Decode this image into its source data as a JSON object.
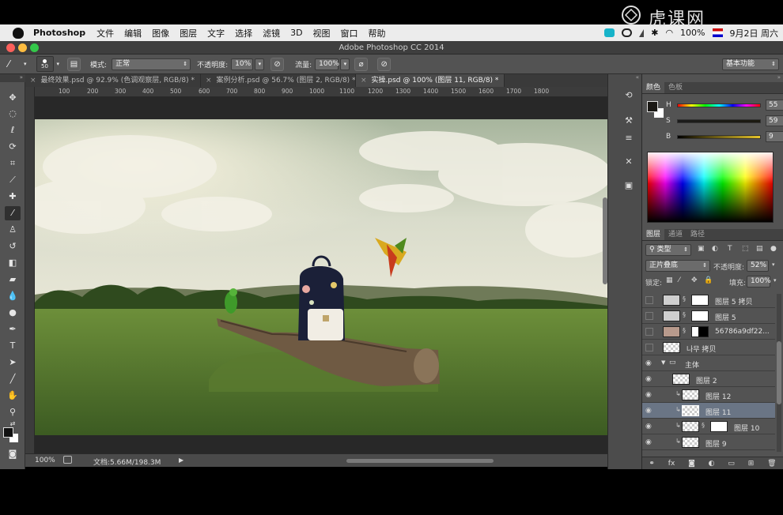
{
  "menubar": {
    "app": "Photoshop",
    "items": [
      "文件",
      "编辑",
      "图像",
      "图层",
      "文字",
      "选择",
      "滤镜",
      "3D",
      "视图",
      "窗口",
      "帮助"
    ],
    "battery": "100%",
    "date": "9月2日 周六",
    "brand": "虎课网"
  },
  "window": {
    "title": "Adobe Photoshop CC 2014"
  },
  "options": {
    "brush_size": "50",
    "mode_label": "模式:",
    "mode_value": "正常",
    "opacity_label": "不透明度:",
    "opacity_value": "10%",
    "flow_label": "流量:",
    "flow_value": "100%",
    "workspace": "基本功能"
  },
  "tabs": [
    {
      "label": "最终效果.psd @ 92.9% (色调观察层, RGB/8) *"
    },
    {
      "label": "案例分析.psd @ 56.7% (图层 2, RGB/8) *"
    },
    {
      "label": "实操.psd @ 100% (图层 11, RGB/8) *"
    }
  ],
  "ruler": {
    "ticks": [
      "100",
      "200",
      "300",
      "400",
      "500",
      "600",
      "700",
      "800",
      "900",
      "1000",
      "1100",
      "1200",
      "1300",
      "1400",
      "1500",
      "1600",
      "1700",
      "1800"
    ]
  },
  "status": {
    "zoom": "100%",
    "doc": "文档:5.66M/198.3M"
  },
  "color_panel": {
    "tabs": [
      "颜色",
      "色板"
    ],
    "h_label": "H",
    "h_value": "55",
    "h_unit": "°",
    "s_label": "S",
    "s_value": "59",
    "s_unit": "%",
    "b_label": "B",
    "b_value": "9",
    "b_unit": "%",
    "foreground": "#1a1814"
  },
  "layers_panel": {
    "tabs": [
      "图层",
      "通道",
      "路径"
    ],
    "filter": "类型",
    "blend_mode": "正片叠底",
    "opacity_label": "不透明度:",
    "opacity_value": "52%",
    "lock_label": "锁定:",
    "fill_label": "填充:",
    "fill_value": "100%",
    "layers": [
      {
        "name": "图层 5 拷贝"
      },
      {
        "name": "图层 5"
      },
      {
        "name": "56786a9df22..."
      },
      {
        "name": "나무 拷贝"
      },
      {
        "name": "主体"
      },
      {
        "name": "图层 2"
      },
      {
        "name": "图层 12"
      },
      {
        "name": "图层 11"
      },
      {
        "name": "图层 10"
      },
      {
        "name": "图层 9"
      }
    ]
  }
}
